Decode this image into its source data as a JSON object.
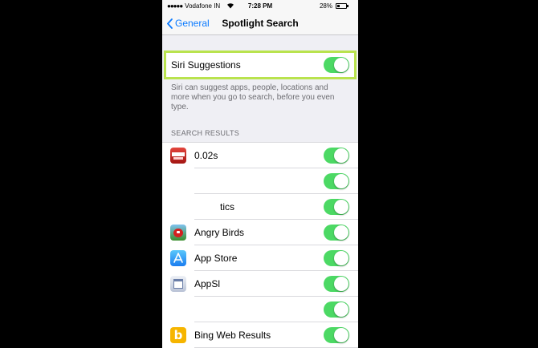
{
  "status_bar": {
    "signal_dots": "●●●●●",
    "carrier": "Vodafone IN",
    "time": "7:28 PM",
    "battery_percent": "28%"
  },
  "nav": {
    "back_label": "General",
    "title": "Spotlight Search"
  },
  "siri": {
    "label": "Siri Suggestions",
    "enabled": true,
    "footer": "Siri can suggest apps, people, locations and more when you go to search, before you even type."
  },
  "section_header": "SEARCH RESULTS",
  "results": [
    {
      "name": "0.02s",
      "icon": "red-app-icon",
      "enabled": true
    },
    {
      "name": "",
      "icon": "blank-app-icon",
      "enabled": true
    },
    {
      "name": "tics",
      "icon": "none",
      "enabled": true
    },
    {
      "name": "Angry Birds",
      "icon": "angry-birds-icon",
      "enabled": true
    },
    {
      "name": "App Store",
      "icon": "app-store-icon",
      "enabled": true
    },
    {
      "name": "AppSl",
      "icon": "calendar-app-icon",
      "enabled": true
    },
    {
      "name": "",
      "icon": "none",
      "enabled": true
    },
    {
      "name": "Bing Web Results",
      "icon": "bing-icon",
      "enabled": true
    }
  ],
  "colors": {
    "accent": "#0a7aff",
    "switch_on": "#4cd964",
    "highlight": "#b9e34e",
    "background": "#efeff4"
  }
}
